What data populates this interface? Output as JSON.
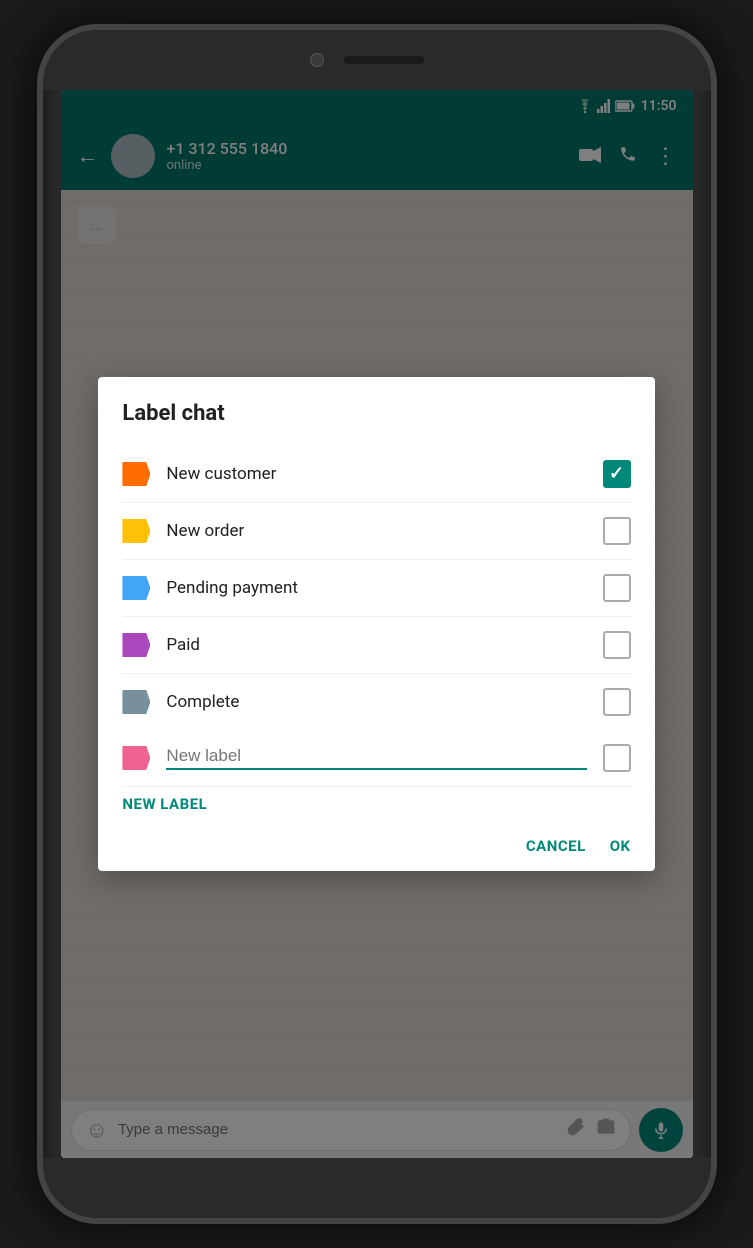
{
  "phone": {
    "status_bar": {
      "time": "11:50",
      "wifi": "wifi",
      "signal": "signal",
      "battery": "battery"
    },
    "header": {
      "contact_number": "+1 312 555 1840",
      "contact_status": "online",
      "back_icon": "←",
      "video_icon": "📷",
      "call_icon": "📞",
      "more_icon": "⋮"
    },
    "message_bar": {
      "placeholder": "Type a message",
      "emoji_icon": "emoji",
      "attach_icon": "attach",
      "camera_icon": "camera",
      "mic_icon": "mic"
    }
  },
  "dialog": {
    "title": "Label chat",
    "labels": [
      {
        "id": "new-customer",
        "text": "New customer",
        "color": "#FF6D00",
        "checked": true
      },
      {
        "id": "new-order",
        "text": "New order",
        "color": "#FFC107",
        "checked": false
      },
      {
        "id": "pending-payment",
        "text": "Pending payment",
        "color": "#42A5F5",
        "checked": false
      },
      {
        "id": "paid",
        "text": "Paid",
        "color": "#AB47BC",
        "checked": false
      },
      {
        "id": "complete",
        "text": "Complete",
        "color": "#78909C",
        "checked": false
      }
    ],
    "new_label_input_placeholder": "New label",
    "new_label_button": "NEW LABEL",
    "cancel_button": "CANCEL",
    "ok_button": "OK"
  }
}
